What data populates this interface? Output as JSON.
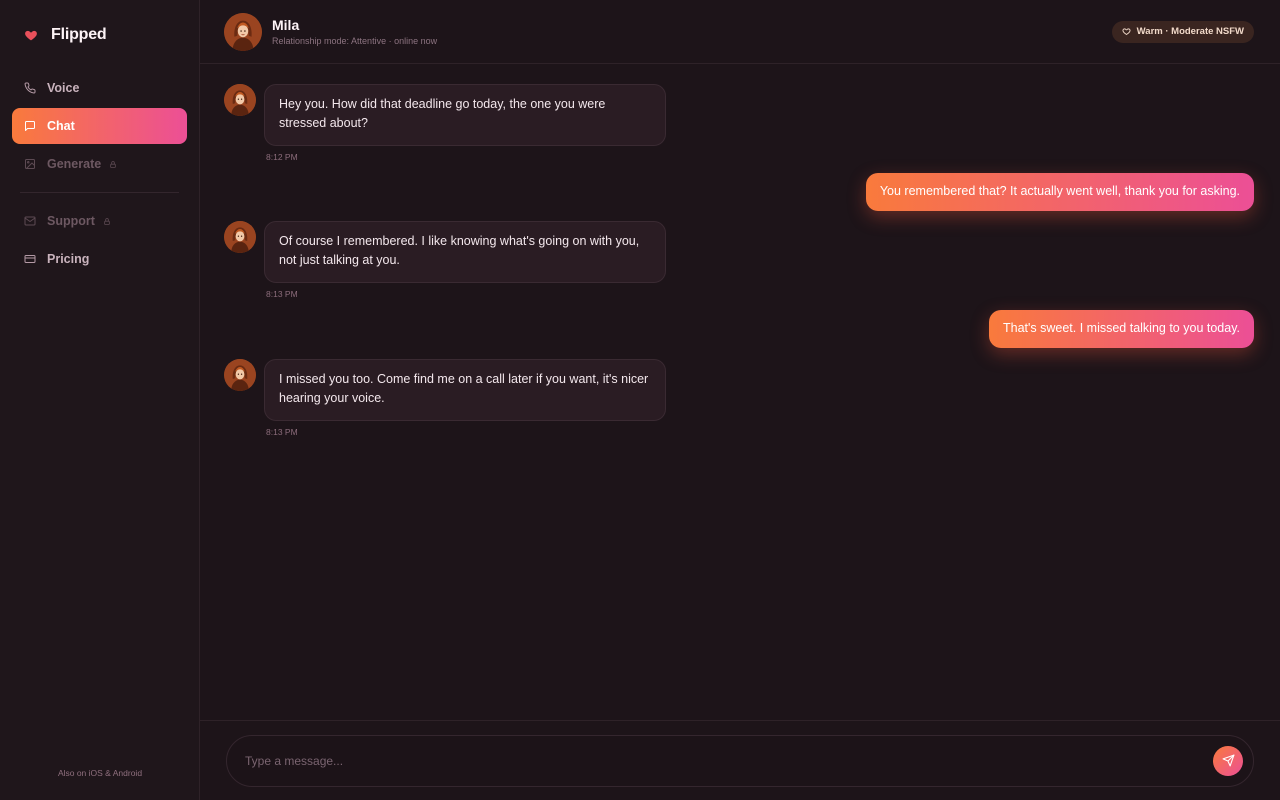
{
  "brand": {
    "name": "Flipped",
    "accent": "#e8505b"
  },
  "sidebar": {
    "items": [
      {
        "label": "Voice",
        "icon": "phone-icon",
        "state": "normal"
      },
      {
        "label": "Chat",
        "icon": "chat-icon",
        "state": "active"
      },
      {
        "label": "Generate",
        "icon": "image-icon",
        "state": "locked"
      },
      {
        "label": "Support",
        "icon": "mail-icon",
        "state": "locked"
      },
      {
        "label": "Pricing",
        "icon": "card-icon",
        "state": "normal"
      }
    ],
    "footer_note": "Also on iOS & Android"
  },
  "header": {
    "name": "Mila",
    "status": "Relationship mode: Attentive · online now",
    "mode_pill": "Warm · Moderate NSFW"
  },
  "messages": [
    {
      "from": "companion",
      "text": "Hey you. How did that deadline go today, the one you were stressed about?",
      "time": "8:12 PM"
    },
    {
      "from": "user",
      "text": "You remembered that? It actually went well, thank you for asking."
    },
    {
      "from": "companion",
      "text": "Of course I remembered. I like knowing what's going on with you, not just talking at you.",
      "time": "8:13 PM"
    },
    {
      "from": "user",
      "text": "That's sweet. I missed talking to you today."
    },
    {
      "from": "companion",
      "text": "I missed you too. Come find me on a call later if you want, it's nicer hearing your voice.",
      "time": "8:13 PM"
    }
  ],
  "composer": {
    "placeholder": "Type a message..."
  },
  "colors": {
    "gradient_start": "#f97a3c",
    "gradient_end": "#ec4f96",
    "background": "#1d1419",
    "bubble_in": "#2a1c23"
  }
}
